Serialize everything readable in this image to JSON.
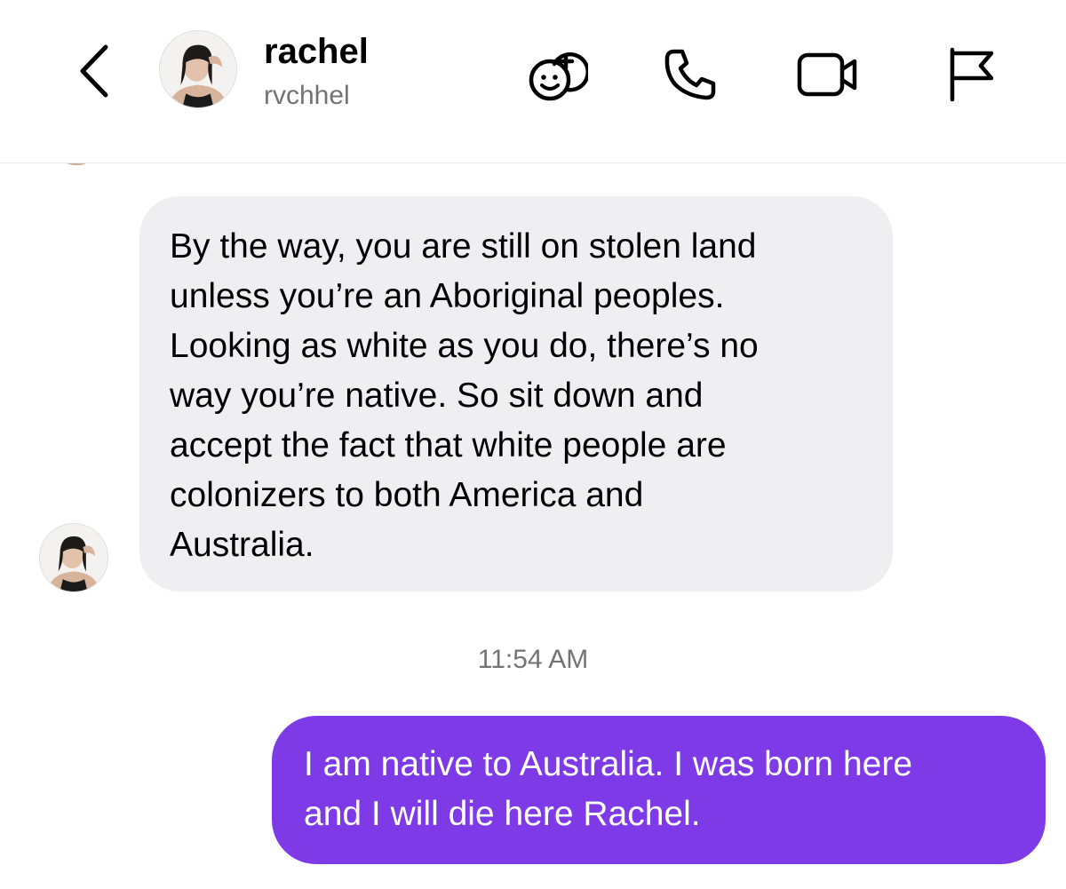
{
  "header": {
    "back_icon": "chevron-left-icon",
    "contact_name": "rachel",
    "contact_username": "rvchhel",
    "actions": [
      {
        "icon": "game-controller-icon"
      },
      {
        "icon": "phone-icon"
      },
      {
        "icon": "video-camera-icon"
      },
      {
        "icon": "flag-icon"
      }
    ]
  },
  "thread": {
    "incoming_message": "By the way, you are still on stolen land\nunless you’re an Aboriginal peoples.\nLooking as white as you do, there’s no\nway you’re native. So sit down and\naccept the fact that white people are\ncolonizers to both America and\nAustralia.",
    "timestamp": "11:54 AM",
    "outgoing_message": "I am native to Australia. I was born here\nand I will die here Rachel."
  },
  "colors": {
    "incoming_bubble": "#efeff1",
    "outgoing_bubble": "#7d3ae6",
    "secondary_text": "#737373"
  }
}
